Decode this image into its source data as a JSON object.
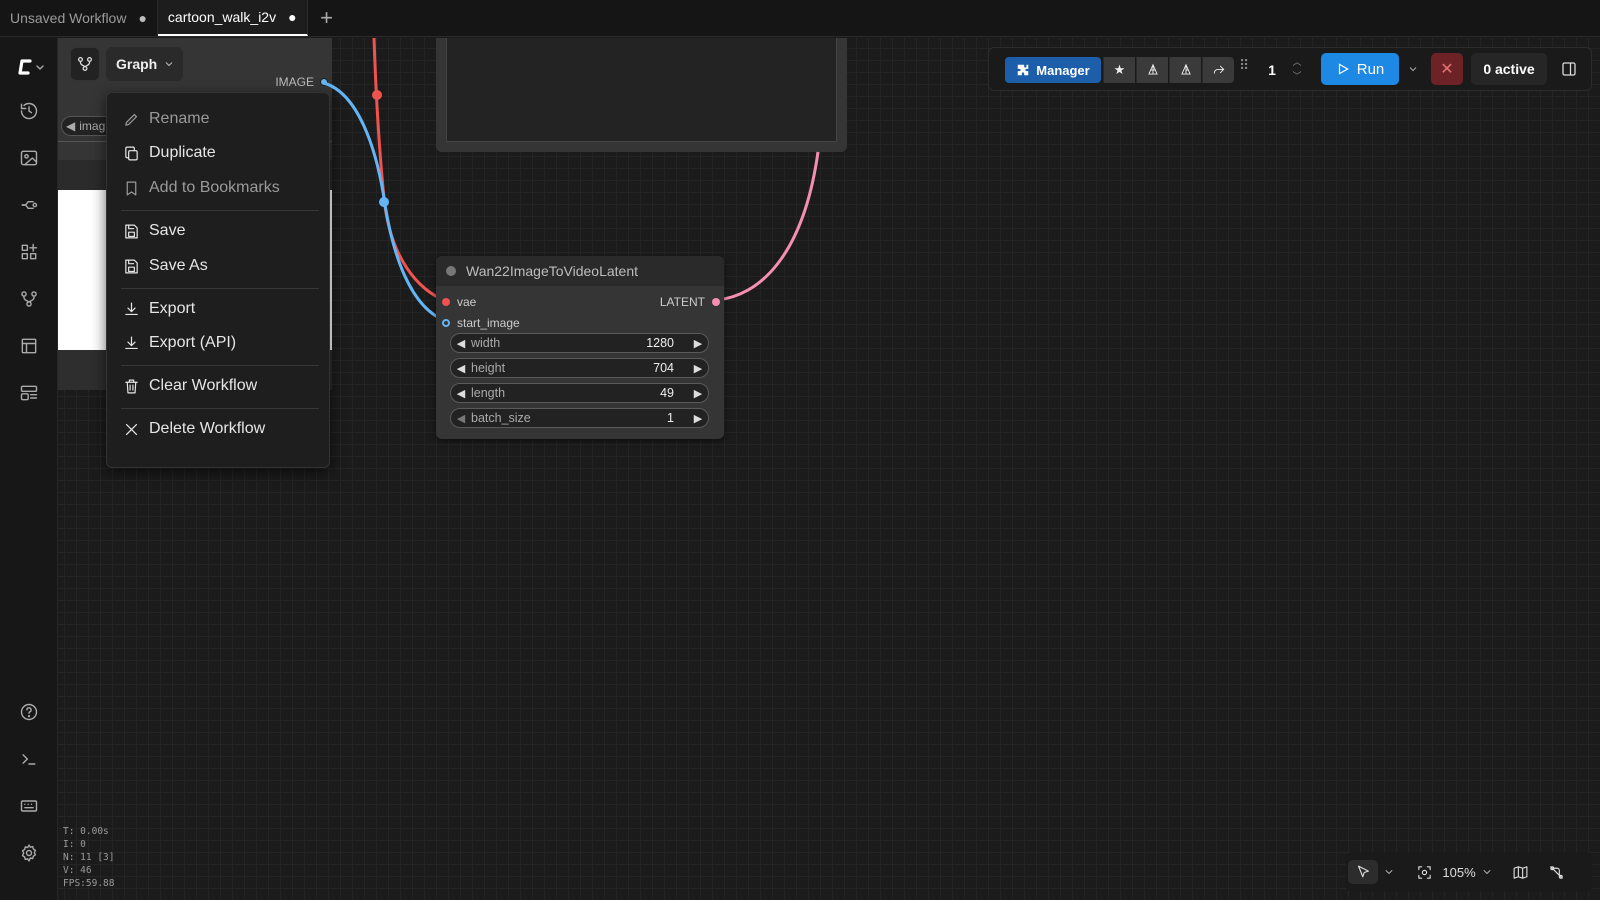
{
  "tabs": [
    {
      "label": "Unsaved Workflow",
      "modified": "●"
    },
    {
      "label": "cartoon_walk_i2v",
      "modified": "●"
    }
  ],
  "new_tab": "+",
  "graph_button": {
    "label": "Graph"
  },
  "context_menu": {
    "items": [
      {
        "label": "Rename",
        "icon": "pencil-icon"
      },
      {
        "label": "Duplicate",
        "icon": "copy-icon"
      },
      {
        "label": "Add to Bookmarks",
        "icon": "bookmark-icon"
      },
      {
        "label": "Save",
        "icon": "save-icon"
      },
      {
        "label": "Save As",
        "icon": "save-icon"
      },
      {
        "label": "Export",
        "icon": "download-icon"
      },
      {
        "label": "Export (API)",
        "icon": "download-icon"
      },
      {
        "label": "Clear Workflow",
        "icon": "trash-icon"
      },
      {
        "label": "Delete Workflow",
        "icon": "close-icon"
      }
    ]
  },
  "left_node": {
    "output_label": "IMAGE",
    "widget_label": "imag"
  },
  "wan_node": {
    "title": "Wan22ImageToVideoLatent",
    "inputs": [
      "vae",
      "start_image"
    ],
    "output": "LATENT",
    "widgets": [
      {
        "label": "width",
        "value": "1280"
      },
      {
        "label": "height",
        "value": "704"
      },
      {
        "label": "length",
        "value": "49"
      },
      {
        "label": "batch_size",
        "value": "1"
      }
    ]
  },
  "toolbar": {
    "manager_label": "Manager",
    "queue_count": "1",
    "run_label": "Run",
    "active_label": "0 active"
  },
  "canvas_controls": {
    "zoom": "105%"
  },
  "stats": {
    "t": "T: 0.00s",
    "i": "I: 0",
    "n": "N: 11 [3]",
    "v": "V: 46",
    "fps": "FPS:59.88"
  },
  "colors": {
    "accent": "#1e88e5",
    "manager": "#1c5eaa",
    "link_vae": "#ef5350",
    "link_image": "#64b5f6",
    "link_latent": "#f48fb1"
  }
}
